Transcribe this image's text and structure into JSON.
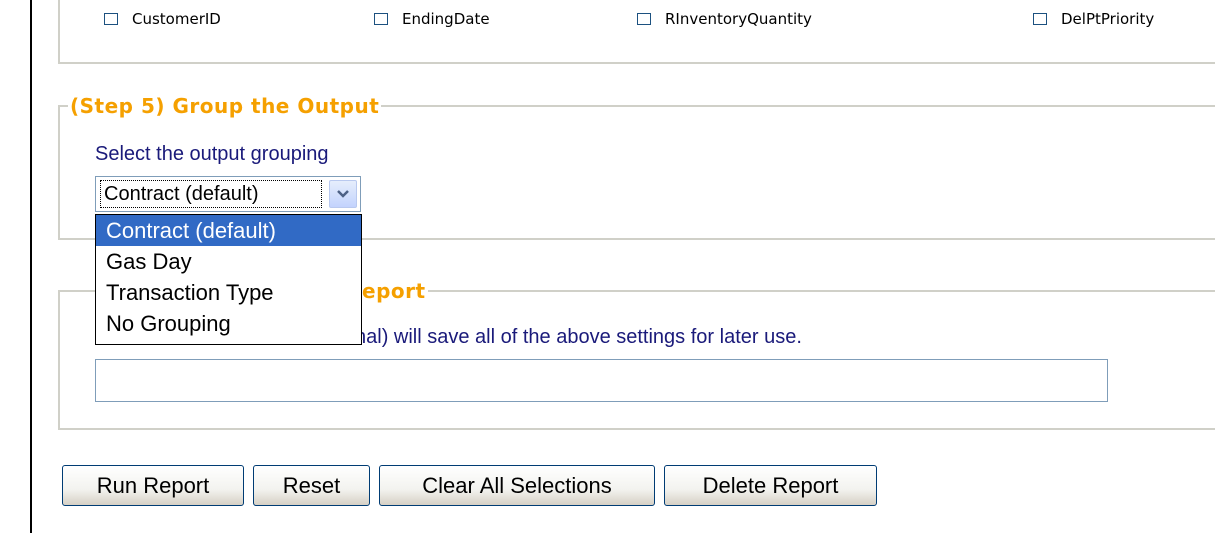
{
  "step4": {
    "checkboxes": [
      {
        "label": "CustomerID",
        "checked": false
      },
      {
        "label": "EndingDate",
        "checked": false
      },
      {
        "label": "RInventoryQuantity",
        "checked": false
      },
      {
        "label": "DelPtPriority",
        "checked": false
      }
    ]
  },
  "step5": {
    "legend": "(Step 5) Group the Output",
    "instruction": "Select the output grouping",
    "select_value": "Contract (default)",
    "options": [
      "Contract (default)",
      "Gas Day",
      "Transaction Type",
      "No Grouping"
    ]
  },
  "step6": {
    "legend_fragment": "eport",
    "description_fragment": "nal) will save all of the above settings for later use.",
    "report_name_value": ""
  },
  "buttons": {
    "run": "Run Report",
    "reset": "Reset",
    "clear": "Clear All Selections",
    "delete": "Delete Report"
  },
  "colors": {
    "legend": "#f5a000",
    "instruction_text": "#1a1a7a",
    "selected_option": "#316ac5"
  }
}
